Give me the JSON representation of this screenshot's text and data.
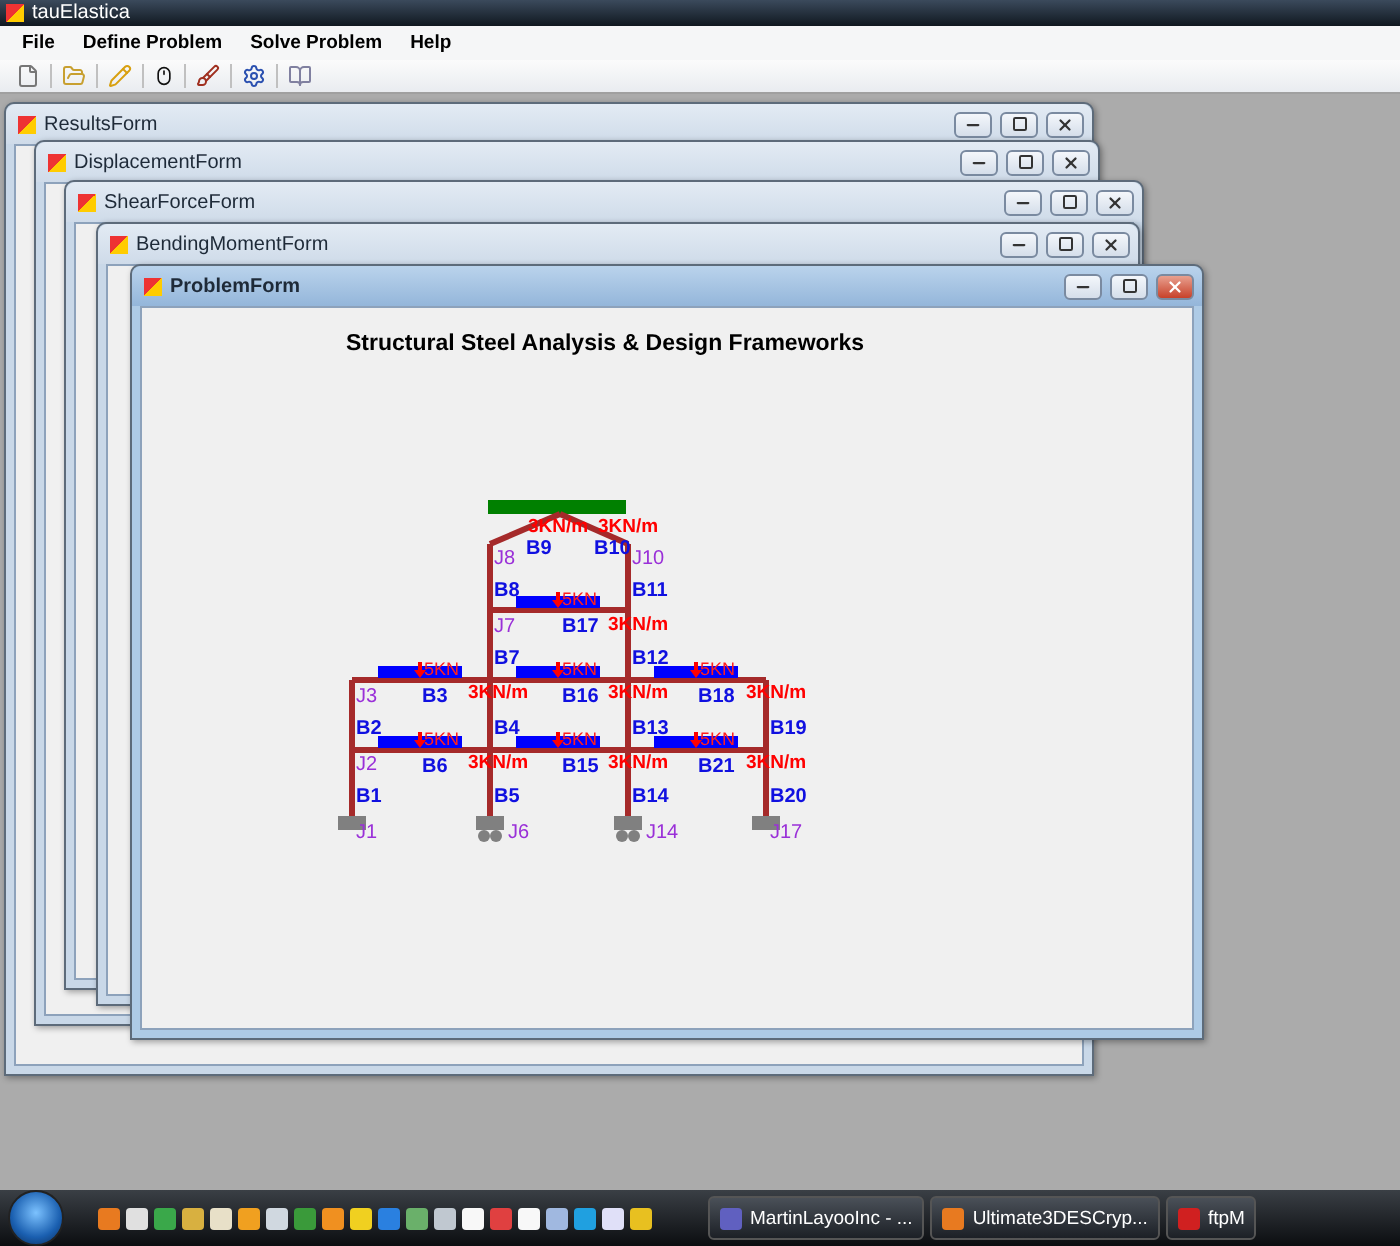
{
  "app": {
    "title": "tauElastica"
  },
  "menu": [
    "File",
    "Define Problem",
    "Solve Problem",
    "Help"
  ],
  "windows": [
    {
      "title": "ResultsForm",
      "active": false
    },
    {
      "title": "DisplacementForm",
      "active": false
    },
    {
      "title": "ShearForceForm",
      "active": false
    },
    {
      "title": "BendingMomentForm",
      "active": false
    },
    {
      "title": "ProblemForm",
      "active": true
    }
  ],
  "problem_form": {
    "heading": "Structural Steel Analysis & Design Frameworks",
    "members": [
      "B9",
      "B10",
      "B8",
      "B11",
      "B17",
      "B7",
      "B12",
      "B3",
      "B16",
      "B18",
      "B2",
      "B4",
      "B13",
      "B19",
      "B6",
      "B15",
      "B21",
      "B1",
      "B5",
      "B14",
      "B20"
    ],
    "joints": [
      "J8",
      "J10",
      "J7",
      "J3",
      "J2",
      "J1",
      "J6",
      "J14",
      "J17"
    ],
    "point_loads": [
      "5KN",
      "5KN",
      "5KN",
      "5KN",
      "5KN",
      "5KN",
      "5KN"
    ],
    "distributed_loads": [
      "3KN/m",
      "3KN/m",
      "3KN/m",
      "3KN/m",
      "3KN/m",
      "3KN/m",
      "3KN/m",
      "3KN/m",
      "3KN/m"
    ],
    "supports": [
      {
        "kind": "fixed"
      },
      {
        "kind": "roller"
      },
      {
        "kind": "roller"
      },
      {
        "kind": "fixed"
      }
    ]
  },
  "taskbar": {
    "buttons": [
      "MartinLayooInc - ...",
      "Ultimate3DESCryp...",
      "ftpM"
    ]
  }
}
